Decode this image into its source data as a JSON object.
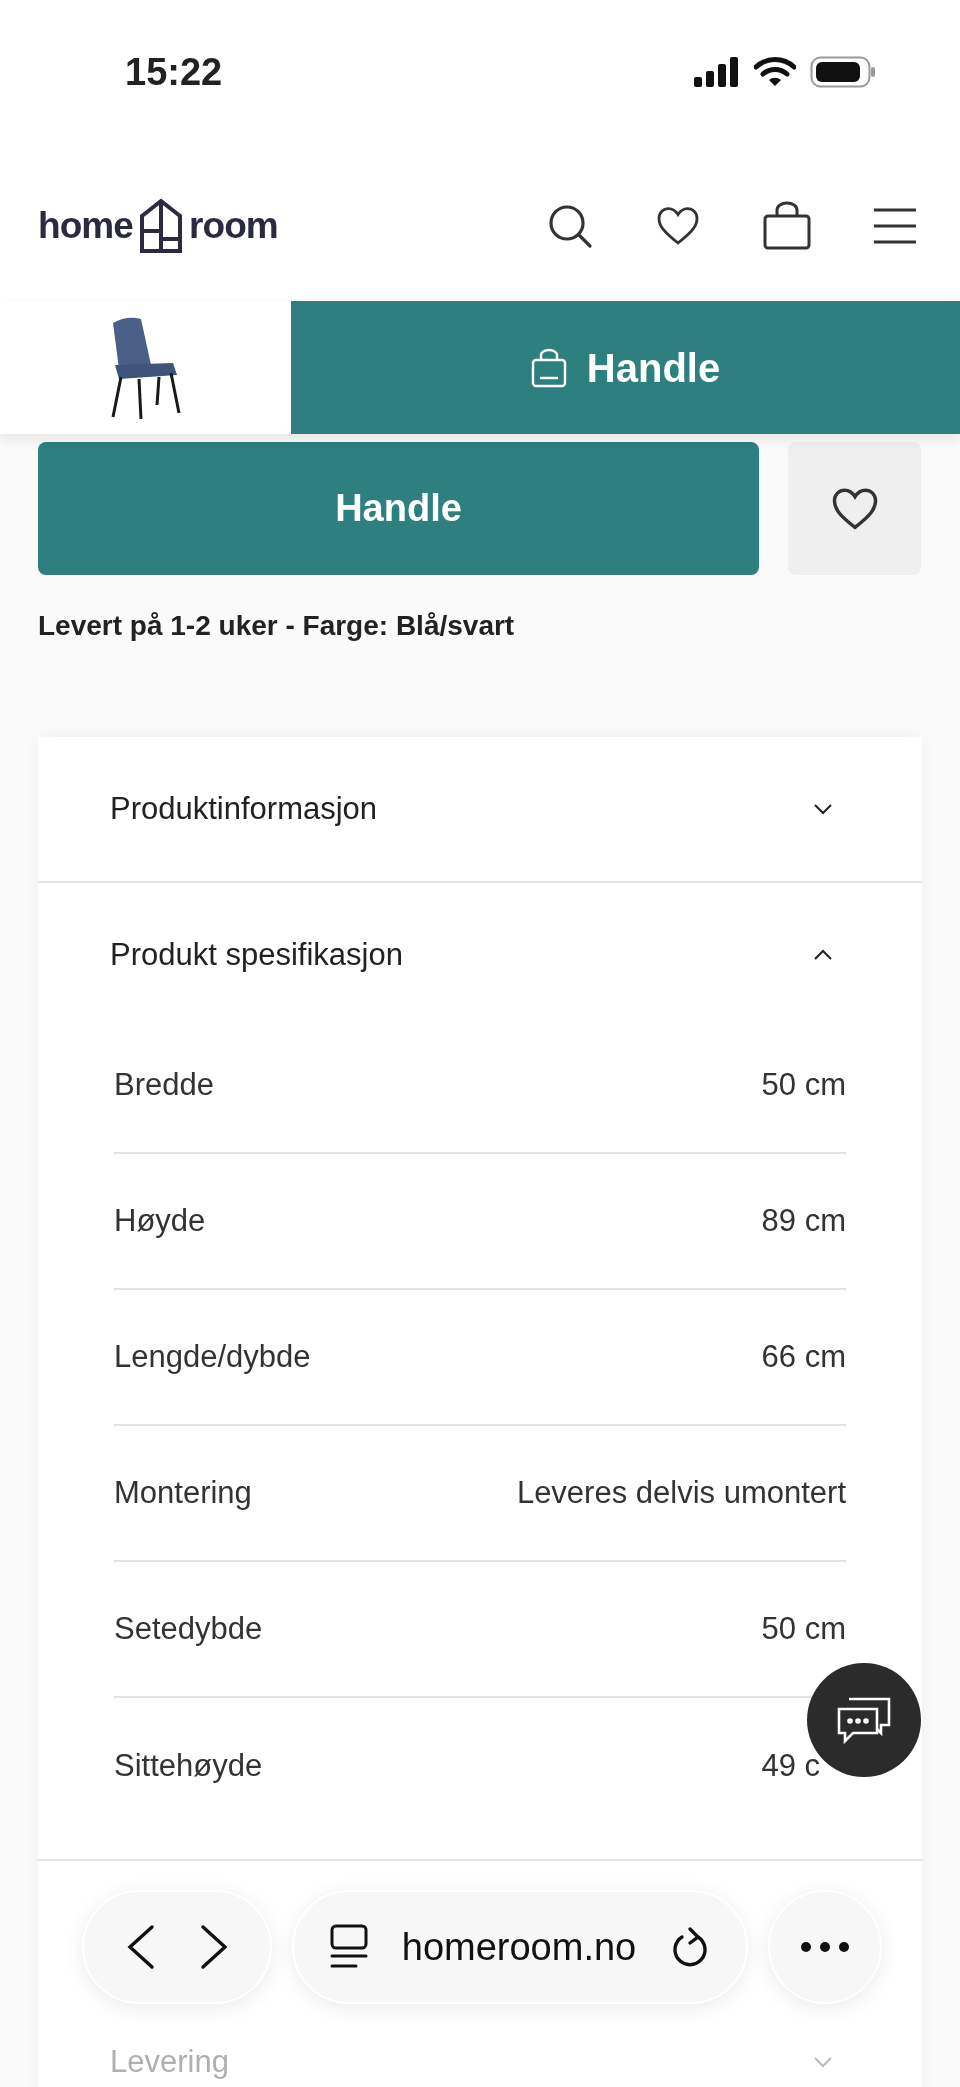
{
  "status_bar": {
    "time": "15:22"
  },
  "header": {
    "logo_left": "home",
    "logo_right": "room"
  },
  "sticky_bar": {
    "button": "Handle"
  },
  "buy": {
    "button": "Handle",
    "note": "Levert på 1-2 uker - Farge: Blå/svart"
  },
  "accordion": [
    {
      "title": "Produktinformasjon",
      "expanded": false
    },
    {
      "title": "Produkt spesifikasjon",
      "expanded": true,
      "specs": [
        {
          "label": "Bredde",
          "value": "50 cm"
        },
        {
          "label": "Høyde",
          "value": "89 cm"
        },
        {
          "label": "Lengde/dybde",
          "value": "66 cm"
        },
        {
          "label": "Montering",
          "value": "Leveres delvis umontert"
        },
        {
          "label": "Setedybde",
          "value": "50 cm"
        },
        {
          "label": "Sittehøyde",
          "value": "49 c"
        }
      ]
    },
    {
      "title": "Levering",
      "expanded": false
    }
  ],
  "browser": {
    "url": "homeroom.no"
  }
}
